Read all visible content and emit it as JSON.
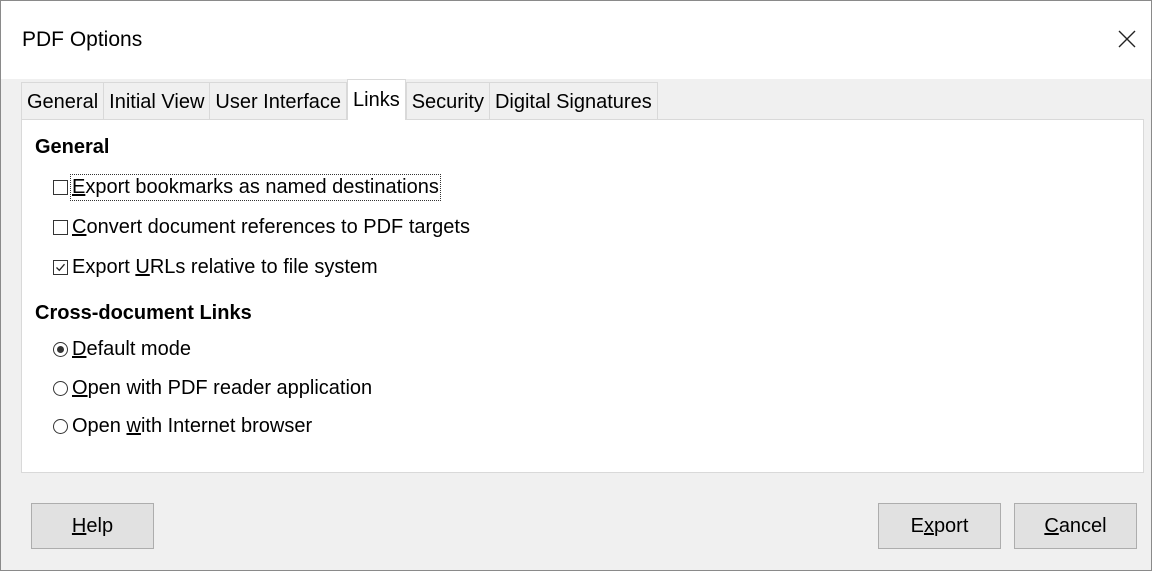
{
  "window": {
    "title": "PDF Options"
  },
  "tabs": [
    {
      "label": "General"
    },
    {
      "label": "Initial View"
    },
    {
      "label": "User Interface"
    },
    {
      "label": "Links"
    },
    {
      "label": "Security"
    },
    {
      "label": "Digital Signatures"
    }
  ],
  "active_tab": "Links",
  "general": {
    "title": "General",
    "options": [
      {
        "pre": "",
        "mnemonic": "E",
        "post": "xport bookmarks as named destinations",
        "checked": false
      },
      {
        "pre": "",
        "mnemonic": "C",
        "post": "onvert document references to PDF targets",
        "checked": false
      },
      {
        "pre": "Export ",
        "mnemonic": "U",
        "post": "RLs relative to file system",
        "checked": true
      }
    ]
  },
  "cross_links": {
    "title": "Cross-document Links",
    "options": [
      {
        "pre": "",
        "mnemonic": "D",
        "post": "efault mode",
        "selected": true
      },
      {
        "pre": "",
        "mnemonic": "O",
        "post": "pen with PDF reader application",
        "selected": false
      },
      {
        "pre": "Open ",
        "mnemonic": "w",
        "post": "ith Internet browser",
        "selected": false
      }
    ]
  },
  "buttons": {
    "help": {
      "pre": "",
      "mnemonic": "H",
      "post": "elp"
    },
    "export": {
      "pre": "E",
      "mnemonic": "x",
      "post": "port"
    },
    "cancel": {
      "pre": "",
      "mnemonic": "C",
      "post": "ancel"
    }
  },
  "icons": {
    "close": "close-icon",
    "check": "checkmark-icon"
  }
}
